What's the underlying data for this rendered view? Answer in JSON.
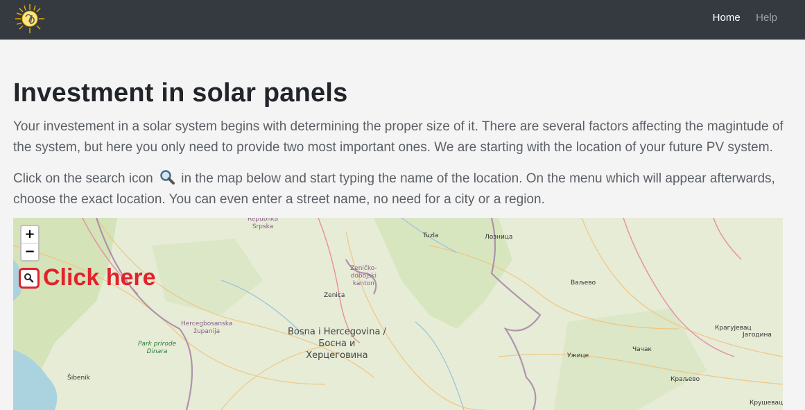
{
  "nav": {
    "links": [
      {
        "label": "Home",
        "active": true
      },
      {
        "label": "Help",
        "active": false
      }
    ]
  },
  "page": {
    "title": "Investment in solar panels",
    "intro": "Your investement in a solar system begins with determining the proper size of it. There are several factors affecting the magintude of the system, but here you only need to provide two most important ones. We are starting with the location of your future PV system.",
    "instruction_before": "Click on the search icon",
    "instruction_after": "in the map below and start typing the name of the location. On the menu which will appear afterwards, choose the exact location. You can even enter a street name, no need for a city or a region."
  },
  "map": {
    "zoom_in": "+",
    "zoom_out": "−",
    "callout": "Click here",
    "labels": {
      "srpska": "Republika\nSrpska",
      "tuzla": "Tuzla",
      "loznica": "Лозница",
      "zenicko": "Zeničko-\ndobojski\nkanton",
      "valjevo": "Ваљево",
      "zenica": "Zenica",
      "hercegbosanska": "Hercegbosanska\nžupanija",
      "bih": "Bosna i Hercegovina /\nБосна и\nХерцеговина",
      "kragujevac": "Крагујевац",
      "jagodina": "Јагодина",
      "park": "Park prirode\nDinara",
      "uzice": "Ужице",
      "cacak": "Чачак",
      "sibenik": "Šibenik",
      "kraljevo": "Краљево",
      "krusevac": "Крушевац"
    }
  },
  "colors": {
    "navbar": "#343a40",
    "accent_red": "#e2222c",
    "map_land": "#e2ead2",
    "sea": "#aad3df"
  }
}
